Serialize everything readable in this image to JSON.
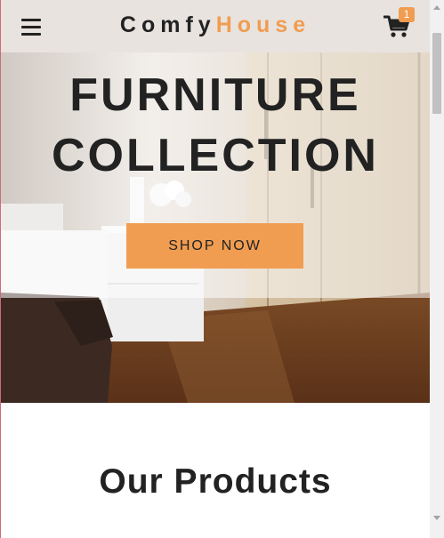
{
  "navbar": {
    "menu_icon": "hamburger-menu-icon",
    "logo_part1": "Comfy",
    "logo_part2": "House",
    "cart_icon": "shopping-cart-icon",
    "cart_count": "1"
  },
  "banner": {
    "title_line1": "FURNITURE",
    "title_line2": "COLLECTION",
    "button_label": "SHOP NOW"
  },
  "products": {
    "title": "Our Products"
  },
  "colors": {
    "accent": "#f09d51",
    "navbar_bg": "#e8e3df",
    "text_dark": "#222222"
  }
}
